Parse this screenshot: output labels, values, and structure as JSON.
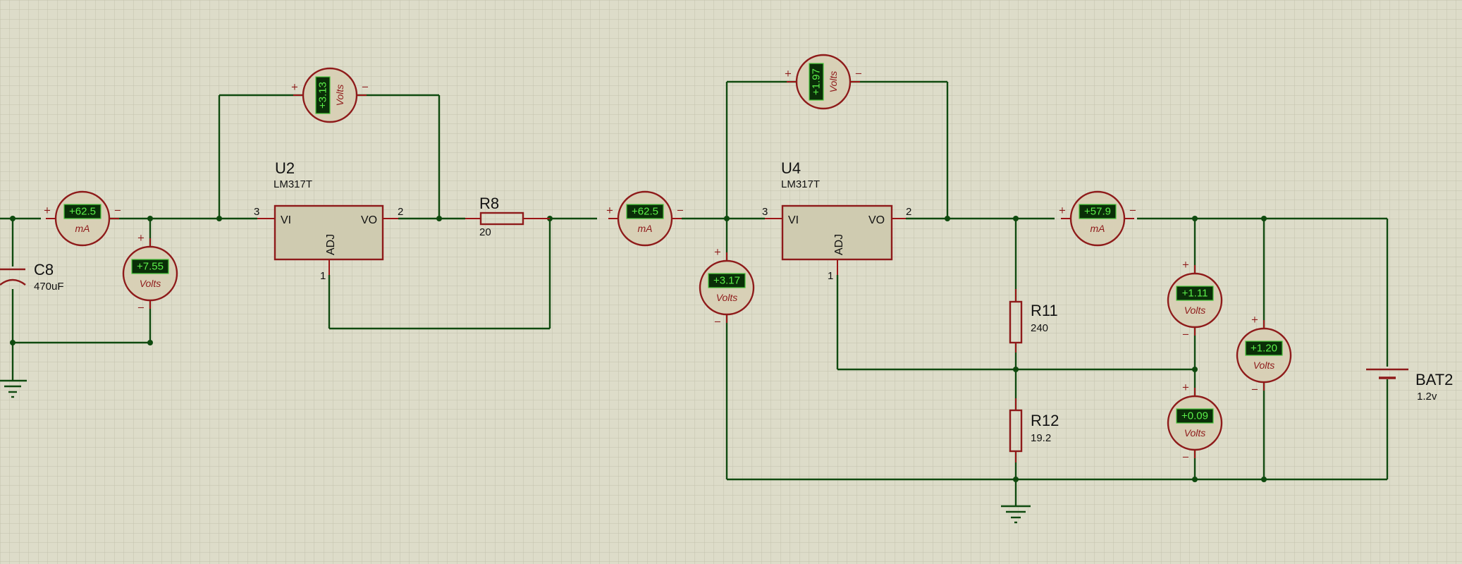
{
  "meters": [
    {
      "id": "ammeter-1",
      "kind": "ammeter",
      "value": "+62.5",
      "unit": "mA"
    },
    {
      "id": "voltmeter-c8",
      "kind": "voltmeter",
      "value": "+7.55",
      "unit": "Volts"
    },
    {
      "id": "voltmeter-u2",
      "kind": "voltmeter",
      "value": "+3.13",
      "unit": "Volts"
    },
    {
      "id": "ammeter-2",
      "kind": "ammeter",
      "value": "+62.5",
      "unit": "mA"
    },
    {
      "id": "voltmeter-u4-in",
      "kind": "voltmeter",
      "value": "+3.17",
      "unit": "Volts"
    },
    {
      "id": "voltmeter-u4",
      "kind": "voltmeter",
      "value": "+1.97",
      "unit": "Volts"
    },
    {
      "id": "ammeter-3",
      "kind": "ammeter",
      "value": "+57.9",
      "unit": "mA"
    },
    {
      "id": "voltmeter-r11",
      "kind": "voltmeter",
      "value": "+1.11",
      "unit": "Volts"
    },
    {
      "id": "voltmeter-r12",
      "kind": "voltmeter",
      "value": "+0.09",
      "unit": "Volts"
    },
    {
      "id": "voltmeter-bat",
      "kind": "voltmeter",
      "value": "+1.20",
      "unit": "Volts"
    }
  ],
  "signs": {
    "plus": "+",
    "minus": "−"
  },
  "components": {
    "c8": {
      "ref": "C8",
      "value": "470uF"
    },
    "u2": {
      "ref": "U2",
      "part": "LM317T",
      "vi": "VI",
      "vo": "VO",
      "adj": "ADJ",
      "pin_in": "3",
      "pin_out": "2",
      "pin_adj": "1"
    },
    "r8": {
      "ref": "R8",
      "value": "20"
    },
    "u4": {
      "ref": "U4",
      "part": "LM317T",
      "vi": "VI",
      "vo": "VO",
      "adj": "ADJ",
      "pin_in": "3",
      "pin_out": "2",
      "pin_adj": "1"
    },
    "r11": {
      "ref": "R11",
      "value": "240"
    },
    "r12": {
      "ref": "R12",
      "value": "19.2"
    },
    "bat2": {
      "ref": "BAT2",
      "value": "1.2v"
    }
  },
  "colors": {
    "wire": "#0f4a0f",
    "component": "#8e1a1a",
    "display": "#5cf04a",
    "background": "#dddcc9"
  }
}
